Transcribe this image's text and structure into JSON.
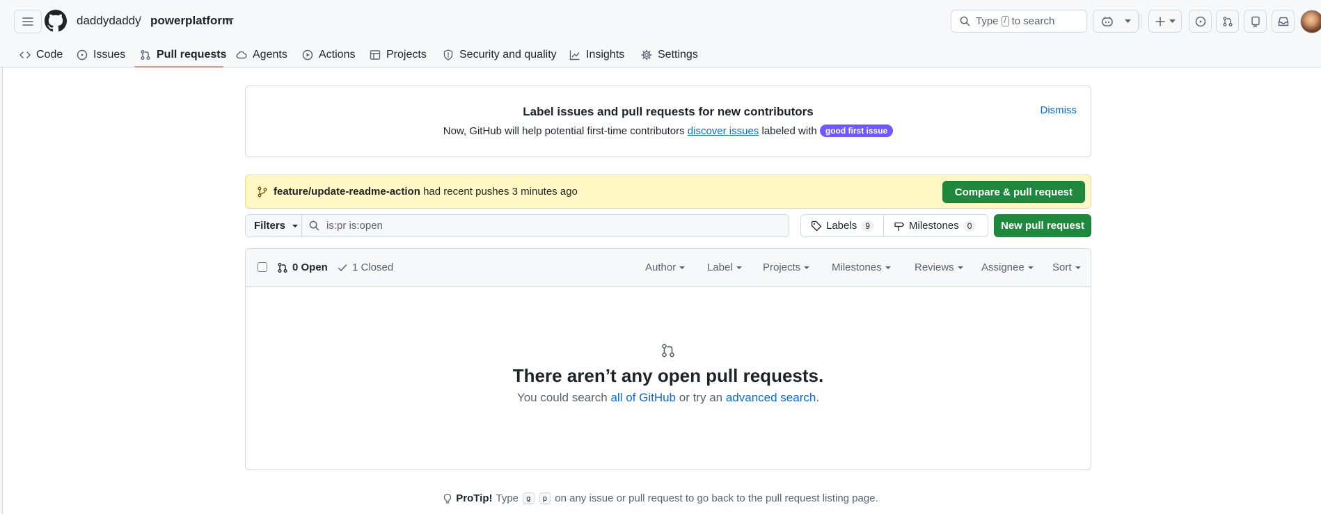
{
  "header": {
    "owner": "daddydaddy",
    "separator": "/",
    "repo": "powerplatform",
    "search": {
      "before": "Type",
      "key": "/",
      "after": "to search"
    }
  },
  "nav": {
    "items": [
      {
        "label": "Code",
        "icon": "code-icon"
      },
      {
        "label": "Issues",
        "icon": "issue-opened-icon"
      },
      {
        "label": "Pull requests",
        "icon": "git-pull-request-icon",
        "selected": true
      },
      {
        "label": "Agents",
        "icon": "agent-icon"
      },
      {
        "label": "Actions",
        "icon": "play-icon"
      },
      {
        "label": "Projects",
        "icon": "table-icon"
      },
      {
        "label": "Security and quality",
        "icon": "shield-icon"
      },
      {
        "label": "Insights",
        "icon": "graph-icon"
      },
      {
        "label": "Settings",
        "icon": "gear-icon"
      }
    ]
  },
  "contributors_banner": {
    "title": "Label issues and pull requests for new contributors",
    "desc_before": "Now, GitHub will help potential first-time contributors",
    "link": "discover issues",
    "desc_after": "labeled with",
    "label": "good first issue",
    "dismiss": "Dismiss"
  },
  "push_banner": {
    "branch": "feature/update-readme-action",
    "text": "had recent pushes 3 minutes ago",
    "button": "Compare & pull request"
  },
  "filter_bar": {
    "filters": "Filters",
    "query": "is:pr is:open",
    "labels": "Labels",
    "labels_count": "9",
    "milestones": "Milestones",
    "milestones_count": "0",
    "new_pr": "New pull request"
  },
  "list": {
    "open": "0 Open",
    "closed": "1 Closed",
    "sorts": [
      "Author",
      "Label",
      "Projects",
      "Milestones",
      "Reviews",
      "Assignee",
      "Sort"
    ],
    "blank_title": "There aren’t any open pull requests.",
    "blank_before": "You could search",
    "blank_link1": "all of GitHub",
    "blank_middle": "or try an",
    "blank_link2": "advanced search",
    "blank_after": "."
  },
  "protip": {
    "label": "ProTip!",
    "before": "Type",
    "key1": "g",
    "key2": "p",
    "after": "on any issue or pull request to go back to the pull request listing page."
  },
  "colors": {
    "primary_button": "#1f883d",
    "link": "#0969da",
    "nav_underline": "#fd8c73",
    "push_banner_bg": "#fff8c5",
    "good_first_issue": "#7057ff"
  }
}
